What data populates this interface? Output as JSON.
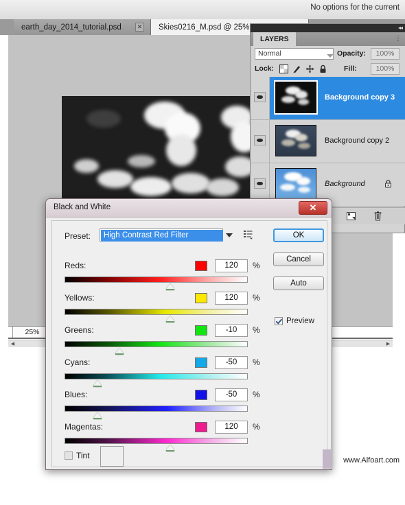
{
  "app": {
    "options_bar_text": "No options for the current",
    "tabs": [
      {
        "label": "earth_day_2014_tutorial.psd",
        "close_icon": "close-icon",
        "active": false
      },
      {
        "label": "Skies0216_M.psd @ 25% (",
        "active": true
      }
    ],
    "zoom_level": "25%",
    "watermark": "www.Alfoart.com"
  },
  "layers_panel": {
    "tab_label": "LAYERS",
    "collapse_icon": "double-chevron-left-icon",
    "menu_icon": "panel-menu-icon",
    "blend_mode": "Normal",
    "blend_arrow_icon": "chevron-down-icon",
    "opacity_label": "Opacity:",
    "opacity_value": "100%",
    "lock_label": "Lock:",
    "lock_icons": [
      "lock-transparency-icon",
      "lock-image-icon",
      "lock-position-icon",
      "lock-all-icon"
    ],
    "fill_label": "Fill:",
    "fill_value": "100%",
    "layers": [
      {
        "name": "Background copy 3",
        "selected": true,
        "visible": true,
        "italic": false,
        "locked": false,
        "eye_icon": "eye-icon",
        "thumb": "dark-clouds-thumb"
      },
      {
        "name": "Background copy 2",
        "selected": false,
        "visible": true,
        "italic": false,
        "locked": false,
        "eye_icon": "eye-icon",
        "thumb": "dim-clouds-thumb"
      },
      {
        "name": "Background",
        "selected": false,
        "visible": true,
        "italic": true,
        "locked": true,
        "eye_icon": "eye-icon",
        "lock_icon": "padlock-icon",
        "thumb": "blue-sky-thumb"
      }
    ],
    "buttons": [
      {
        "icon": "new-group-icon"
      },
      {
        "icon": "new-layer-icon"
      },
      {
        "icon": "trash-icon"
      }
    ]
  },
  "dialog": {
    "title": "Black and White",
    "close_icon": "close-icon",
    "preset_label": "Preset:",
    "preset_value": "High Contrast Red Filter",
    "preset_dropdown_icon": "chevron-down-icon",
    "preset_menu_icon": "preset-options-icon",
    "buttons": {
      "ok": "OK",
      "cancel": "Cancel",
      "auto": "Auto"
    },
    "preview": {
      "label": "Preview",
      "checked": true
    },
    "tint": {
      "label": "Tint",
      "checked": false,
      "swatch_color": "#efefef"
    },
    "sliders": [
      {
        "label": "Reds:",
        "value": "120",
        "unit": "%",
        "swatch": "#ff0000",
        "gradient_mid": "#ff1e1e",
        "thumb_pct": 65
      },
      {
        "label": "Yellows:",
        "value": "120",
        "unit": "%",
        "swatch": "#ffe800",
        "gradient_mid": "#e8e800",
        "thumb_pct": 65
      },
      {
        "label": "Greens:",
        "value": "-10",
        "unit": "%",
        "swatch": "#13e513",
        "gradient_mid": "#12e512",
        "thumb_pct": 36
      },
      {
        "label": "Cyans:",
        "value": "-50",
        "unit": "%",
        "swatch": "#13a8e8",
        "gradient_mid": "#23e8e8",
        "thumb_pct": 24
      },
      {
        "label": "Blues:",
        "value": "-50",
        "unit": "%",
        "swatch": "#1212e8",
        "gradient_mid": "#2020ff",
        "thumb_pct": 24
      },
      {
        "label": "Magentas:",
        "value": "120",
        "unit": "%",
        "swatch": "#ee1d8f",
        "gradient_mid": "#ff2ad0",
        "thumb_pct": 65
      }
    ]
  }
}
